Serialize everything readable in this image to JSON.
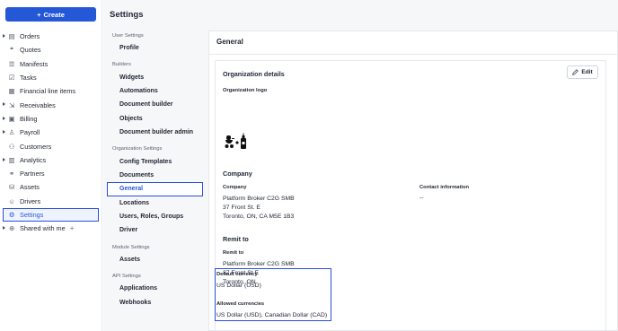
{
  "create": {
    "label": "Create"
  },
  "sidebar": {
    "items": [
      {
        "label": "Orders",
        "icon": "clipboard-icon",
        "caret": true
      },
      {
        "label": "Quotes",
        "icon": "quote-icon",
        "caret": false
      },
      {
        "label": "Manifests",
        "icon": "manifest-icon",
        "caret": false
      },
      {
        "label": "Tasks",
        "icon": "checkbox-icon",
        "caret": false
      },
      {
        "label": "Financial line items",
        "icon": "ledger-icon",
        "caret": false
      },
      {
        "label": "Receivables",
        "icon": "receivables-icon",
        "caret": true
      },
      {
        "label": "Billing",
        "icon": "billing-icon",
        "caret": true
      },
      {
        "label": "Payroll",
        "icon": "payroll-icon",
        "caret": true
      },
      {
        "label": "Customers",
        "icon": "users-icon",
        "caret": false
      },
      {
        "label": "Analytics",
        "icon": "chart-icon",
        "caret": true
      },
      {
        "label": "Partners",
        "icon": "partners-icon",
        "caret": false
      },
      {
        "label": "Assets",
        "icon": "assets-icon",
        "caret": false
      },
      {
        "label": "Drivers",
        "icon": "driver-icon",
        "caret": false
      },
      {
        "label": "Settings",
        "icon": "gear-icon",
        "caret": false,
        "active": true
      },
      {
        "label": "Shared with me",
        "icon": "globe-icon",
        "caret": true,
        "plus": "+"
      }
    ]
  },
  "header": {
    "title": "Settings"
  },
  "subnav": {
    "user_settings": "User Settings",
    "profile": "Profile",
    "builders": "Builders",
    "widgets": "Widgets",
    "automations": "Automations",
    "document_builder": "Document builder",
    "objects": "Objects",
    "document_builder_admin": "Document builder admin",
    "organization_settings": "Organization Settings",
    "config_templates": "Config Templates",
    "documents": "Documents",
    "general": "General",
    "locations": "Locations",
    "users_roles_groups": "Users, Roles, Groups",
    "driver": "Driver",
    "module_settings": "Module Settings",
    "assets": "Assets",
    "api_settings": "API Settings",
    "applications": "Applications",
    "webhooks": "Webhooks"
  },
  "content": {
    "title": "General",
    "org_details": "Organization details",
    "edit": "Edit",
    "org_logo_label": "Organization logo",
    "company_title": "Company",
    "company_label": "Company",
    "company_lines": [
      "Platform Broker C2G SMB",
      "37 Front St. E",
      "Toronto, ON, CA M5E 1B3"
    ],
    "contact_label": "Contact information",
    "contact_value": "--",
    "remit_title": "Remit to",
    "remit_label": "Remit to",
    "remit_lines": [
      "Platform Broker C2G SMB",
      "37 Front St E",
      "Toronto, ON"
    ],
    "default_currency_label": "Default currency",
    "default_currency_value": "US Dollar (USD)",
    "allowed_currencies_label": "Allowed currencies",
    "allowed_currencies_value": "US Dollar (USD), Canadian Dollar (CAD)"
  },
  "colors": {
    "accent": "#2458d6",
    "highlight": "#2a4ee0"
  }
}
